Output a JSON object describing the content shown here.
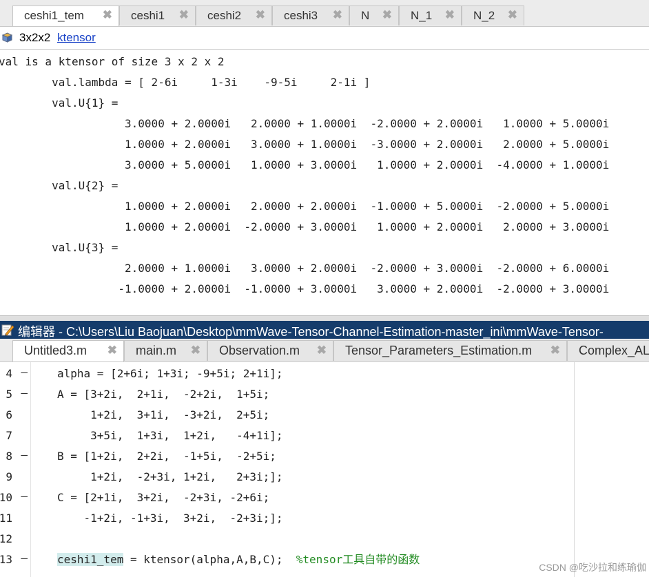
{
  "variables": {
    "tabs": [
      {
        "label": "ceshi1_tem",
        "active": true
      },
      {
        "label": "ceshi1",
        "active": false
      },
      {
        "label": "ceshi2",
        "active": false
      },
      {
        "label": "ceshi3",
        "active": false
      },
      {
        "label": "N",
        "active": false
      },
      {
        "label": "N_1",
        "active": false
      },
      {
        "label": "N_2",
        "active": false
      }
    ],
    "close_glyph": "✖",
    "info": {
      "size": "3x2x2",
      "class_link": "ktensor"
    },
    "output": [
      "val is a ktensor of size 3 x 2 x 2",
      "        val.lambda = [ 2-6i     1-3i    -9-5i     2-1i ]",
      "        val.U{1} =",
      "                   3.0000 + 2.0000i   2.0000 + 1.0000i  -2.0000 + 2.0000i   1.0000 + 5.0000i",
      "                   1.0000 + 2.0000i   3.0000 + 1.0000i  -3.0000 + 2.0000i   2.0000 + 5.0000i",
      "                   3.0000 + 5.0000i   1.0000 + 3.0000i   1.0000 + 2.0000i  -4.0000 + 1.0000i",
      "        val.U{2} =",
      "                   1.0000 + 2.0000i   2.0000 + 2.0000i  -1.0000 + 5.0000i  -2.0000 + 5.0000i",
      "                   1.0000 + 2.0000i  -2.0000 + 3.0000i   1.0000 + 2.0000i   2.0000 + 3.0000i",
      "        val.U{3} =",
      "                   2.0000 + 1.0000i   3.0000 + 2.0000i  -2.0000 + 3.0000i  -2.0000 + 6.0000i",
      "                  -1.0000 + 2.0000i  -1.0000 + 3.0000i   3.0000 + 2.0000i  -2.0000 + 3.0000i"
    ]
  },
  "editor": {
    "title": "编辑器 - C:\\Users\\Liu Baojuan\\Desktop\\mmWave-Tensor-Channel-Estimation-master_ini\\mmWave-Tensor-",
    "tabs": [
      {
        "label": "Untitled3.m",
        "active": true
      },
      {
        "label": "main.m",
        "active": false
      },
      {
        "label": "Observation.m",
        "active": false
      },
      {
        "label": "Tensor_Parameters_Estimation.m",
        "active": false
      },
      {
        "label": "Complex_AL",
        "active": false
      }
    ],
    "lines": [
      {
        "num": "4",
        "dash": "—",
        "code": "alpha = [2+6i; 1+3i; -9+5i; 2+1i];"
      },
      {
        "num": "5",
        "dash": "—",
        "code": "A = [3+2i,  2+1i,  -2+2i,  1+5i;"
      },
      {
        "num": "6",
        "dash": "",
        "code": "     1+2i,  3+1i,  -3+2i,  2+5i;"
      },
      {
        "num": "7",
        "dash": "",
        "code": "     3+5i,  1+3i,  1+2i,   -4+1i];"
      },
      {
        "num": "8",
        "dash": "—",
        "code": "B = [1+2i,  2+2i,  -1+5i,  -2+5i;"
      },
      {
        "num": "9",
        "dash": "",
        "code": "     1+2i,  -2+3i, 1+2i,   2+3i;];"
      },
      {
        "num": "10",
        "dash": "—",
        "code": "C = [2+1i,  3+2i,  -2+3i, -2+6i;"
      },
      {
        "num": "11",
        "dash": "",
        "code": "    -1+2i, -1+3i,  3+2i,  -2+3i;];"
      },
      {
        "num": "12",
        "dash": "",
        "code": ""
      },
      {
        "num": "13",
        "dash": "—",
        "var": "ceshi1_tem",
        "code": " = ktensor(alpha,A,B,C);  ",
        "comment": "%tensor工具自带的函数"
      }
    ]
  },
  "watermark": "CSDN @吃沙拉和练瑜伽",
  "colors": {
    "title_bar": "#153c6b",
    "link": "#1c45c8",
    "comment": "#228b22",
    "highlight": "#d2ecec"
  }
}
